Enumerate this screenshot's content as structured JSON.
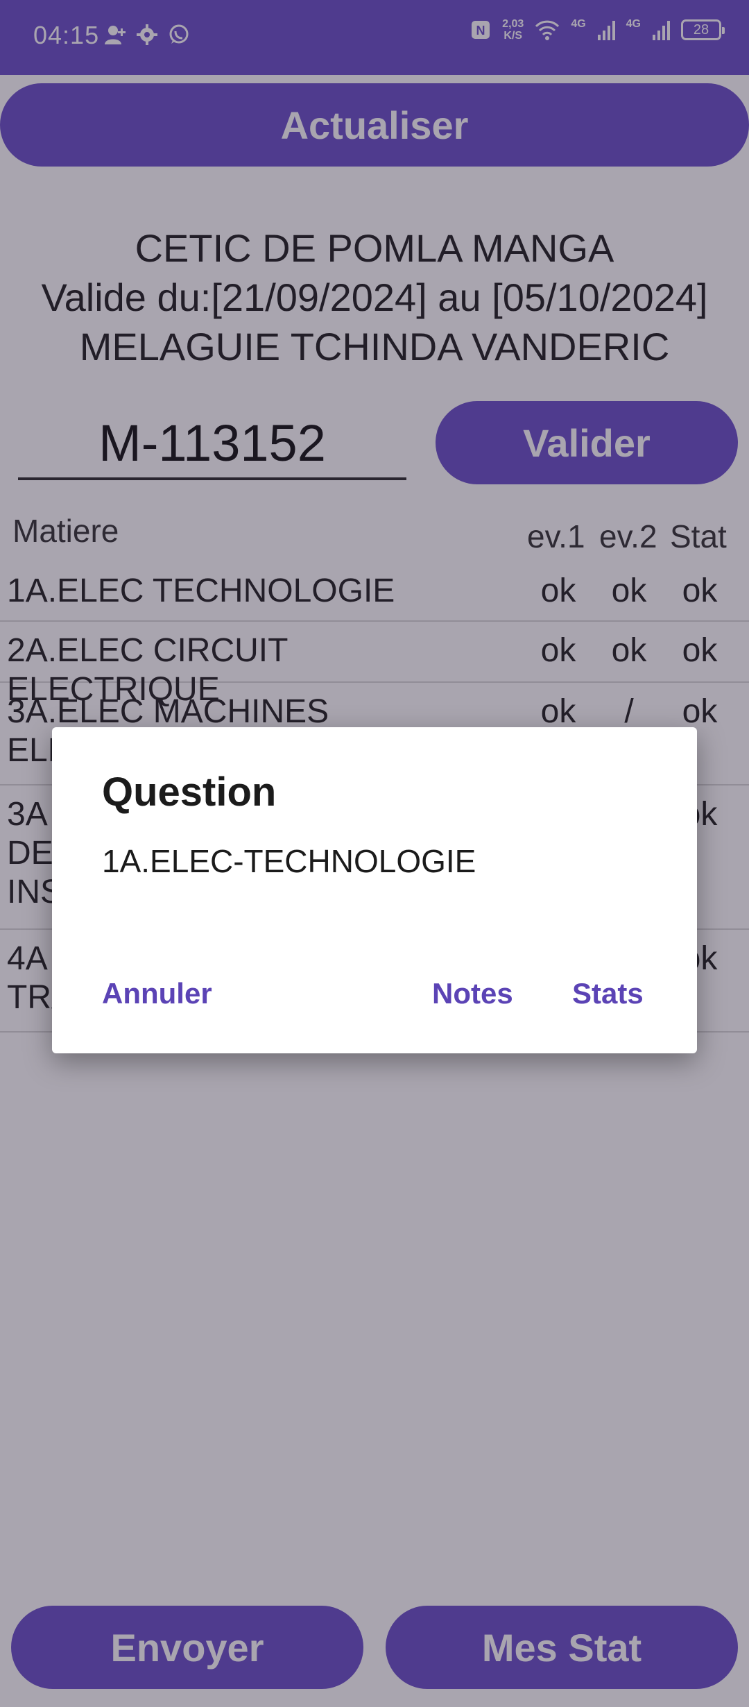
{
  "status_bar": {
    "time": "04:15",
    "left_icons": [
      "person-add-icon",
      "gear-icon",
      "whatsapp-icon"
    ],
    "nfc_label": "N",
    "net_speed_value": "2,03",
    "net_speed_unit": "K/S",
    "network_1": "4G",
    "network_2": "4G",
    "battery": "28"
  },
  "buttons": {
    "refresh": "Actualiser",
    "validate": "Valider",
    "send": "Envoyer",
    "my_stats": "Mes Stat"
  },
  "header": {
    "school": "CETIC DE POMLA MANGA",
    "validity": "Valide du:[21/09/2024] au [05/10/2024]",
    "student": "MELAGUIE TCHINDA VANDERIC"
  },
  "code_input": {
    "value": "M-113152"
  },
  "table": {
    "headers": {
      "subject": "Matiere",
      "ev1": "ev.1",
      "ev2": "ev.2",
      "stat": "Stat"
    },
    "rows": [
      {
        "subject": "1A.ELEC TECHNOLOGIE",
        "ev1": "ok",
        "ev2": "ok",
        "stat": "ok"
      },
      {
        "subject": "2A.ELEC CIRCUIT ELECTRIQUE",
        "ev1": "ok",
        "ev2": "ok",
        "stat": "ok"
      },
      {
        "subject": "3A.ELEC MACHINES ELE",
        "ev1": "ok",
        "ev2": "/",
        "stat": "ok"
      },
      {
        "subject": "3A DE INS",
        "ev1": "",
        "ev2": "",
        "stat": "ok"
      },
      {
        "subject": "4A TRA",
        "ev1": "",
        "ev2": "",
        "stat": "ok"
      }
    ]
  },
  "dialog": {
    "title": "Question",
    "message": "1A.ELEC-TECHNOLOGIE",
    "cancel": "Annuler",
    "notes": "Notes",
    "stats": "Stats"
  },
  "colors": {
    "primary": "#6a4fc9",
    "dialog_button": "#5b43b5",
    "background": "#ffffff"
  }
}
